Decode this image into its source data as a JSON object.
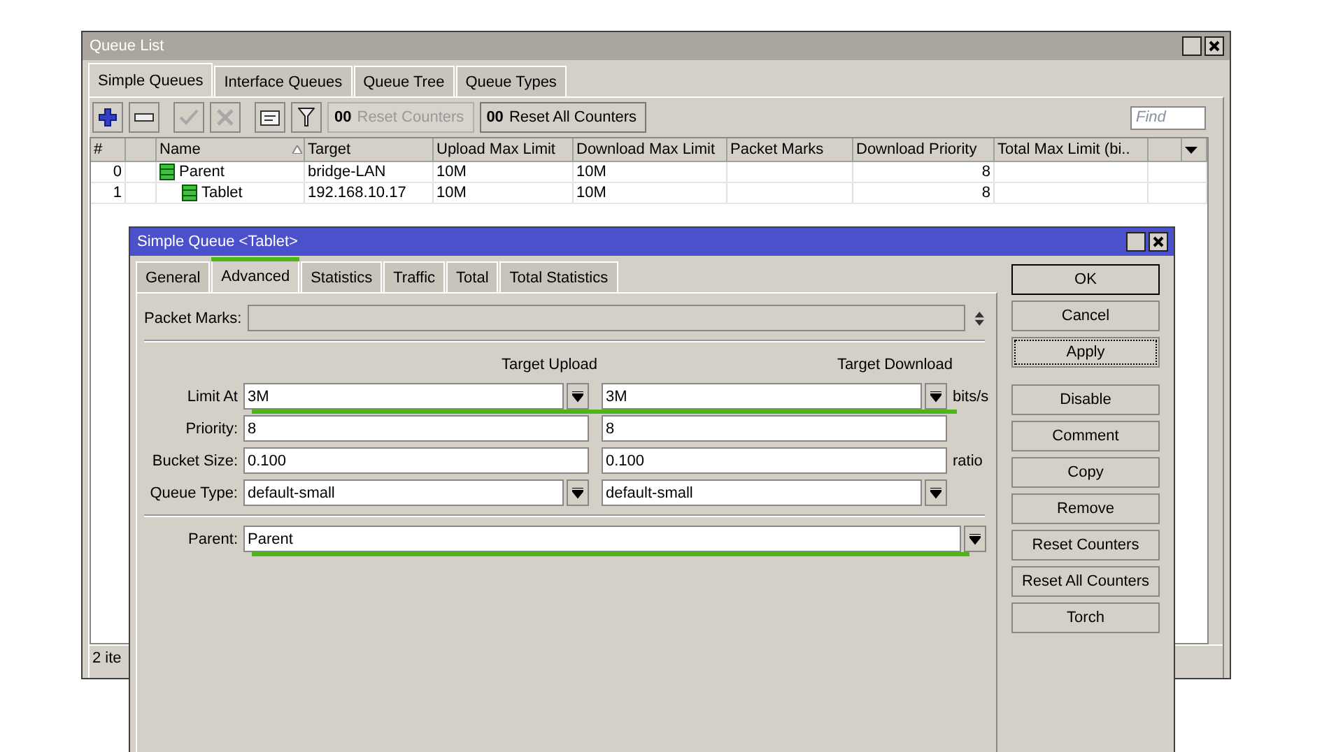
{
  "queue_list": {
    "title": "Queue List",
    "tabs": [
      {
        "label": "Simple Queues",
        "selected": true
      },
      {
        "label": "Interface Queues",
        "selected": false
      },
      {
        "label": "Queue Tree",
        "selected": false
      },
      {
        "label": "Queue Types",
        "selected": false
      }
    ],
    "tools": [
      {
        "kind": "add",
        "disabled": false
      },
      {
        "kind": "remove",
        "disabled": false
      },
      {
        "kind": "enable",
        "disabled": true
      },
      {
        "kind": "disable",
        "disabled": true
      },
      {
        "kind": "comment",
        "disabled": false
      },
      {
        "kind": "filter",
        "disabled": false
      }
    ],
    "counter_buttons": [
      {
        "prefix": "00",
        "label": "Reset Counters",
        "disabled": true
      },
      {
        "prefix": "00",
        "label": "Reset All Counters",
        "disabled": false
      }
    ],
    "find": {
      "placeholder": "Find"
    },
    "table": {
      "columns": [
        {
          "label": "#",
          "sorted": false
        },
        {
          "label": "Name",
          "sorted": true
        },
        {
          "label": "Target",
          "sorted": false
        },
        {
          "label": "Upload Max Limit",
          "sorted": false
        },
        {
          "label": "Download Max Limit",
          "sorted": false
        },
        {
          "label": "Packet Marks",
          "sorted": false
        },
        {
          "label": "Download Priority",
          "sorted": false
        },
        {
          "label": "Total Max Limit (bi..",
          "sorted": false
        }
      ],
      "rows": [
        {
          "number": "0",
          "name": "Parent",
          "target": "bridge-LAN",
          "upload_max_limit": "10M",
          "download_max_limit": "10M",
          "download_priority": "8",
          "children": [
            {
              "number": "1",
              "name": "Tablet",
              "target": "192.168.10.17",
              "upload_max_limit": "10M",
              "download_max_limit": "10M",
              "download_priority": "8"
            }
          ]
        }
      ]
    },
    "status_bar": "2 ite"
  },
  "dialog": {
    "title": "Simple Queue <Tablet>",
    "tabs": [
      {
        "label": "General",
        "selected": false
      },
      {
        "label": "Advanced",
        "selected": true
      },
      {
        "label": "Statistics",
        "selected": false
      },
      {
        "label": "Traffic",
        "selected": false
      },
      {
        "label": "Total",
        "selected": false
      },
      {
        "label": "Total Statistics",
        "selected": false
      }
    ],
    "packet_marks": {
      "label": "Packet Marks:",
      "disabled": true
    },
    "column_headers": [
      "Target Upload",
      "Target Download"
    ],
    "rows": [
      {
        "label": "Limit At",
        "upload": "3M",
        "download": "3M",
        "dropdown": true,
        "unit": "bits/s",
        "highlighted": true
      },
      {
        "label": "Priority:",
        "upload": "8",
        "download": "8",
        "dropdown": false,
        "highlighted": false
      },
      {
        "label": "Bucket Size:",
        "upload": "0.100",
        "download": "0.100",
        "dropdown": false,
        "unit": "ratio",
        "highlighted": false
      },
      {
        "label": "Queue Type:",
        "upload": "default-small",
        "download": "default-small",
        "dropdown": true,
        "highlighted": false
      }
    ],
    "parent": {
      "label": "Parent:",
      "value": "Parent",
      "highlighted": true
    },
    "buttons": [
      {
        "label": "OK",
        "default": true,
        "focused": false
      },
      {
        "label": "Cancel",
        "default": false,
        "focused": false
      },
      {
        "label": "Apply",
        "default": false,
        "focused": true
      }
    ],
    "actions": [
      {
        "label": "Disable"
      },
      {
        "label": "Comment"
      },
      {
        "label": "Copy"
      },
      {
        "label": "Remove"
      },
      {
        "label": "Reset Counters"
      },
      {
        "label": "Reset All Counters"
      },
      {
        "label": "Torch"
      }
    ]
  }
}
